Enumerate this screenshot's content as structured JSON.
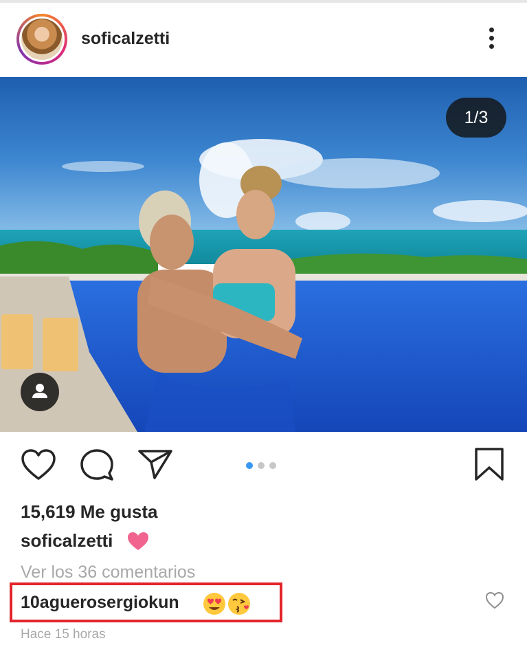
{
  "post": {
    "username": "soficalzetti",
    "counter": "1/3",
    "likes": "15,619 Me gusta",
    "caption_user": "soficalzetti",
    "view_comments": "Ver los 36 comentarios",
    "comment_user": "10aguerosergiokun",
    "timestamp": "Hace 15 horas",
    "carousel": {
      "total": 3,
      "active": 1
    }
  },
  "icons": {
    "more": "more-vertical-icon",
    "like": "heart-outline-icon",
    "comment": "comment-bubble-icon",
    "share": "paper-plane-icon",
    "save": "bookmark-icon",
    "tag": "person-tag-icon",
    "caption_emoji": "pink-heart-emoji",
    "comment_emojis": [
      "heart-eyes-emoji",
      "kissing-heart-emoji"
    ]
  },
  "colors": {
    "highlight_border": "#e3242b",
    "carousel_active": "#3897f0",
    "pink_heart": "#f0648f"
  }
}
